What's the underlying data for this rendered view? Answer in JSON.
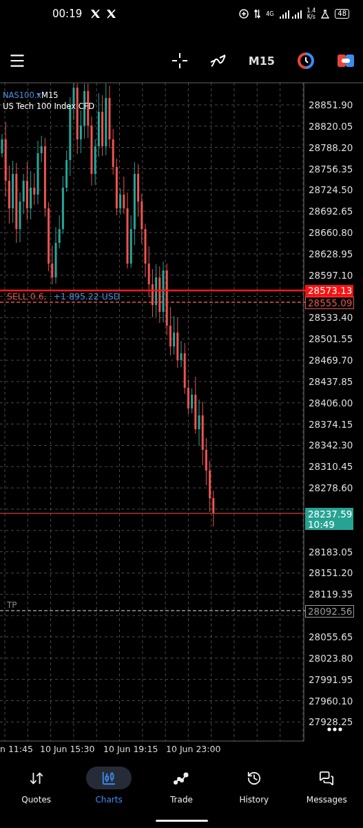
{
  "status_bar": {
    "time": "00:19",
    "network": "4G",
    "speed": "1.4",
    "speed_unit": "K/s",
    "battery": "48"
  },
  "toolbar": {
    "timeframe": "M15"
  },
  "chart": {
    "symbol": "NAS100.x",
    "timeframe": "M15",
    "description": "US Tech 100 Index CFD",
    "price_labels": [
      "28851.90",
      "28820.05",
      "28788.20",
      "28756.35",
      "28724.50",
      "28692.65",
      "28660.80",
      "28628.95",
      "28597.10",
      "28533.40",
      "28501.55",
      "28469.70",
      "28437.85",
      "28406.00",
      "28374.15",
      "28342.30",
      "28310.45",
      "28278.60",
      "28183.05",
      "28151.20",
      "28119.35",
      "28055.65",
      "28023.80",
      "27991.95",
      "27960.10",
      "27928.25"
    ],
    "time_labels": [
      "n 11:45",
      "10 Jun 15:30",
      "10 Jun 19:15",
      "10 Jun 23:00"
    ],
    "upper_line_price": "28573.13",
    "position": {
      "side": "SELL 0.6,",
      "profit": "+1 895.22 USD",
      "open_price": "28555.09"
    },
    "current_price": "28237.59",
    "countdown": "10:49",
    "take_profit": {
      "label": "TP",
      "price": "28092.56"
    }
  },
  "nav": [
    {
      "label": "Quotes",
      "selected": false
    },
    {
      "label": "Charts",
      "selected": true
    },
    {
      "label": "Trade",
      "selected": false
    },
    {
      "label": "History",
      "selected": false
    },
    {
      "label": "Messages",
      "selected": false
    }
  ]
}
